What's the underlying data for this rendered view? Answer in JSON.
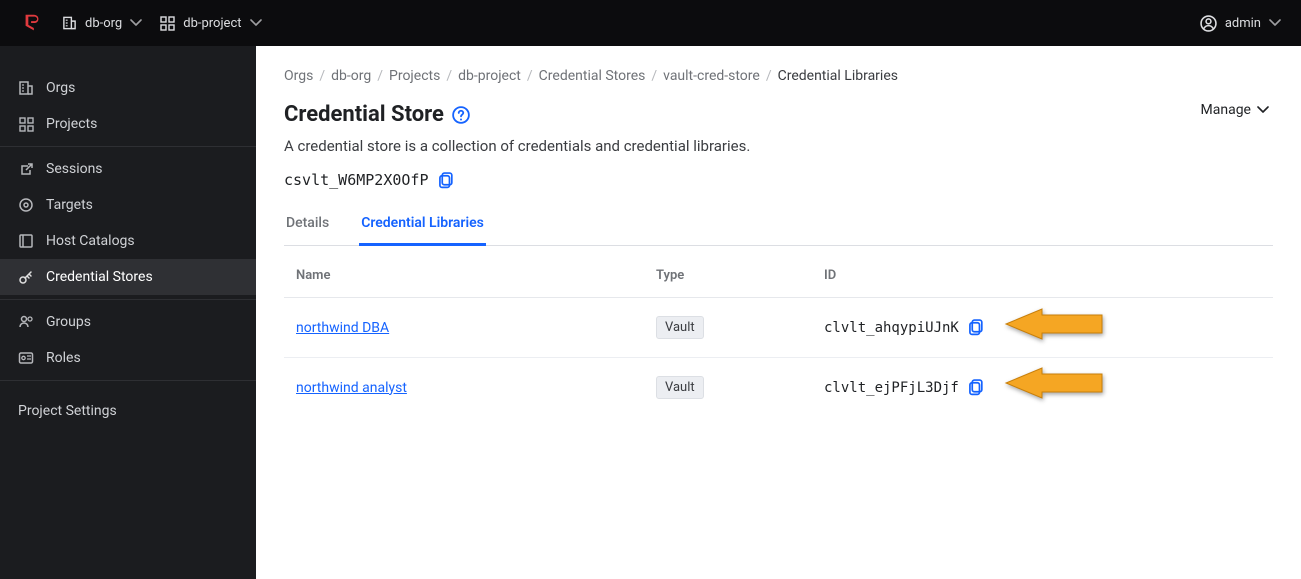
{
  "topbar": {
    "org": "db-org",
    "project": "db-project",
    "user": "admin"
  },
  "sidebar": {
    "orgs": "Orgs",
    "projects": "Projects",
    "sessions": "Sessions",
    "targets": "Targets",
    "host_catalogs": "Host Catalogs",
    "credential_stores": "Credential Stores",
    "groups": "Groups",
    "roles": "Roles",
    "settings": "Project Settings"
  },
  "breadcrumbs": {
    "items": [
      {
        "label": "Orgs"
      },
      {
        "label": "db-org"
      },
      {
        "label": "Projects"
      },
      {
        "label": "db-project"
      },
      {
        "label": "Credential Stores"
      },
      {
        "label": "vault-cred-store"
      },
      {
        "label": "Credential Libraries"
      }
    ]
  },
  "page": {
    "title": "Credential Store",
    "subtitle": "A credential store is a collection of credentials and credential libraries.",
    "manage_label": "Manage",
    "store_id": "csvlt_W6MP2X0OfP"
  },
  "tabs": {
    "details": "Details",
    "credential_libraries": "Credential Libraries"
  },
  "table": {
    "headers": {
      "name": "Name",
      "type": "Type",
      "id": "ID"
    },
    "rows": [
      {
        "name": "northwind DBA",
        "type": "Vault",
        "id": "clvlt_ahqypiUJnK"
      },
      {
        "name": "northwind analyst",
        "type": "Vault",
        "id": "clvlt_ejPFjL3Djf"
      }
    ]
  },
  "icons": {
    "chevron_down": "chevron-down-icon",
    "copy": "copy-icon",
    "help": "help-icon"
  }
}
